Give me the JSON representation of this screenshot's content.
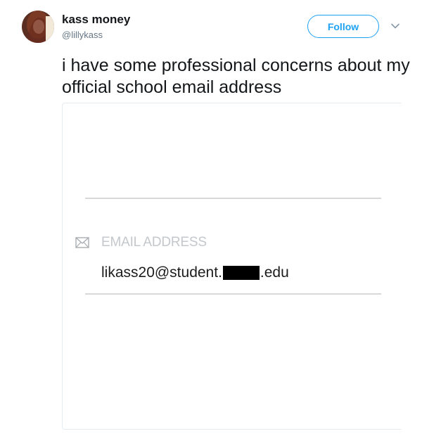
{
  "tweet": {
    "author": {
      "display_name": "kass money",
      "username": "@lillykass"
    },
    "follow_label": "Follow",
    "text": "i have some professional concerns about my official school email address",
    "media": {
      "field_label": "EMAIL ADDRESS",
      "email_prefix": "likass20@student.",
      "email_suffix": ".edu"
    }
  },
  "colors": {
    "accent": "#1da1f2",
    "secondary_text": "#657786",
    "placeholder": "#c4c8cc"
  },
  "icons": {
    "avatar": "avatar-photo",
    "caret": "chevron-down-icon",
    "field_icon": "envelope-icon"
  }
}
